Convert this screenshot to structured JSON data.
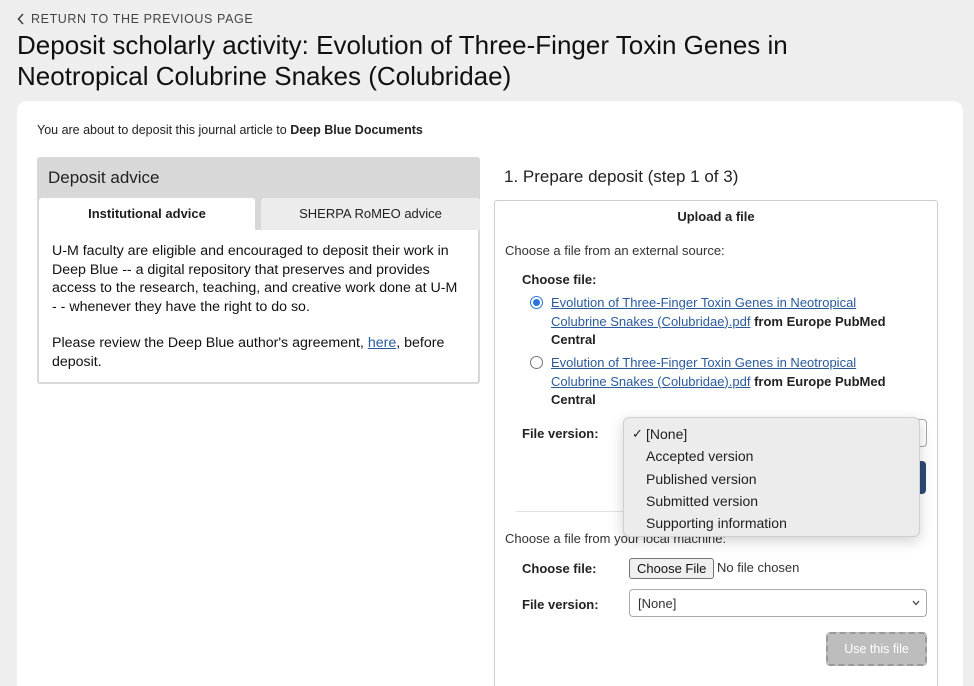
{
  "nav": {
    "back_label": "RETURN TO THE PREVIOUS PAGE"
  },
  "page": {
    "title": "Deposit scholarly activity: Evolution of Three-Finger Toxin Genes in Neotropical Colubrine Snakes (Colubridae)"
  },
  "intro": {
    "prefix": "You are about to deposit this journal article to",
    "repository": "Deep Blue Documents"
  },
  "advice": {
    "heading": "Deposit advice",
    "tabs": [
      {
        "label": "Institutional advice",
        "active": true
      },
      {
        "label": "SHERPA RoMEO advice",
        "active": false
      }
    ],
    "paragraph1": "U-M faculty are eligible and encouraged to deposit their work in Deep Blue -- a digital repository that preserves and provides access to the research, teaching, and creative work done at U-M - - whenever they have the right to do so.",
    "paragraph2_before": "Please review the Deep Blue author's agreement,",
    "paragraph2_link": "here",
    "paragraph2_after": ", before deposit."
  },
  "step": {
    "title": "1. Prepare deposit (step 1 of 3)"
  },
  "upload": {
    "heading": "Upload a file",
    "external_label": "Choose a file from an external source:",
    "choose_file_label": "Choose file:",
    "options": [
      {
        "link": "Evolution of Three-Finger Toxin Genes in Neotropical Colubrine Snakes (Colubridae).pdf",
        "source": "from Europe PubMed Central",
        "selected": true
      },
      {
        "link": "Evolution of Three-Finger Toxin Genes in Neotropical Colubrine Snakes (Colubridae).pdf",
        "source": "from Europe PubMed Central",
        "selected": false
      }
    ],
    "file_version_label": "File version:",
    "local_label": "Choose a file from your local machine:",
    "local_choose_file_label": "Choose file:",
    "choose_button": "Choose File",
    "no_file": "No file chosen",
    "local_file_version_label": "File version:",
    "local_version_value": "[None]",
    "use_button": "Use this file"
  },
  "version_menu": {
    "selected": "[None]",
    "options": [
      "[None]",
      "Accepted version",
      "Published version",
      "Submitted version",
      "Supporting information"
    ]
  },
  "colors": {
    "background": "#eeeeef",
    "link": "#2a5a9c",
    "primary_button": "#2c4a78",
    "radio_accent": "#2a74d9"
  }
}
